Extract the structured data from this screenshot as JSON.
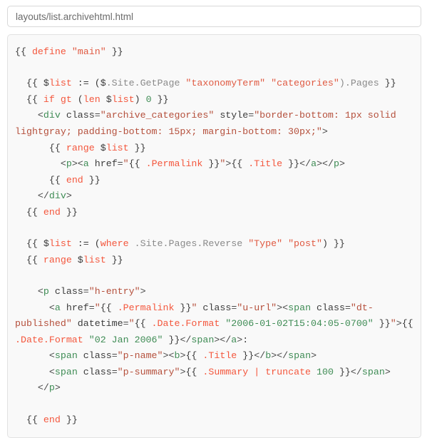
{
  "path_input": {
    "value": "layouts/list.archivehtml.html",
    "placeholder": "layouts/list.archivehtml.html"
  },
  "colors": {
    "background": "#ffffff",
    "panel_background": "#f9f9f9",
    "panel_border": "#e2e2e2",
    "input_border": "#d8d8d8",
    "input_text": "#6b6b6b",
    "code_text": "#3a3a3a",
    "keyword": "#f4573d",
    "go_string": "#e05a42",
    "number": "#3f8c55",
    "object_path": "#8a8a8a",
    "html_tag": "#3f8c55",
    "html_attr_value": "#b5503c"
  },
  "code": {
    "language": "go-html-template",
    "full_text": "{{ define \"main\" }}\n\n  {{ $list := ($.Site.GetPage \"taxonomyTerm\" \"categories\").Pages }}\n  {{ if gt (len $list) 0 }}\n    <div class=\"archive_categories\" style=\"border-bottom: 1px solid lightgray; padding-bottom: 15px; margin-bottom: 30px;\">\n      {{ range $list }}\n        <p><a href=\"{{ .Permalink }}\">{{ .Title }}</a></p>\n      {{ end }}\n    </div>\n  {{ end }}\n\n  {{ $list := (where .Site.Pages.Reverse \"Type\" \"post\") }}\n  {{ range $list }}\n\n    <p class=\"h-entry\">\n      <a href=\"{{ .Permalink }}\" class=\"u-url\"><span class=\"dt-published\" datetime=\"{{ .Date.Format \"2006-01-02T15:04:05-0700\" }}\">{{ .Date.Format \"02 Jan 2006\" }}</span></a>:\n      <span class=\"p-name\"><b>{{ .Title }}</b></span>\n      <span class=\"p-summary\">{{ .Summary | truncate 100 }}</span>\n    </p>\n\n  {{ end }}",
    "lines": [
      {
        "id": "l1",
        "text": "{{ define \"main\" }}"
      },
      {
        "id": "l2",
        "text": ""
      },
      {
        "id": "l3",
        "text": "  {{ $list := ($.Site.GetPage \"taxonomyTerm\" \"categories\").Pages }}"
      },
      {
        "id": "l4",
        "text": "  {{ if gt (len $list) 0 }}"
      },
      {
        "id": "l5",
        "text": "    <div class=\"archive_categories\" style=\"border-bottom: 1px solid lightgray; padding-bottom: 15px; margin-bottom: 30px;\">"
      },
      {
        "id": "l6",
        "text": "      {{ range $list }}"
      },
      {
        "id": "l7",
        "text": "        <p><a href=\"{{ .Permalink }}\">{{ .Title }}</a></p>"
      },
      {
        "id": "l8",
        "text": "      {{ end }}"
      },
      {
        "id": "l9",
        "text": "    </div>"
      },
      {
        "id": "l10",
        "text": "  {{ end }}"
      },
      {
        "id": "l11",
        "text": ""
      },
      {
        "id": "l12",
        "text": "  {{ $list := (where .Site.Pages.Reverse \"Type\" \"post\") }}"
      },
      {
        "id": "l13",
        "text": "  {{ range $list }}"
      },
      {
        "id": "l14",
        "text": ""
      },
      {
        "id": "l15",
        "text": "    <p class=\"h-entry\">"
      },
      {
        "id": "l16",
        "text": "      <a href=\"{{ .Permalink }}\" class=\"u-url\"><span class=\"dt-published\" datetime=\"{{ .Date.Format \"2006-01-02T15:04:05-0700\" }}\">{{ .Date.Format \"02 Jan 2006\" }}</span></a>:"
      },
      {
        "id": "l17",
        "text": "      <span class=\"p-name\"><b>{{ .Title }}</b></span>"
      },
      {
        "id": "l18",
        "text": "      <span class=\"p-summary\">{{ .Summary | truncate 100 }}</span>"
      },
      {
        "id": "l19",
        "text": "    </p>"
      },
      {
        "id": "l20",
        "text": ""
      },
      {
        "id": "l21",
        "text": "  {{ end }}"
      }
    ]
  }
}
